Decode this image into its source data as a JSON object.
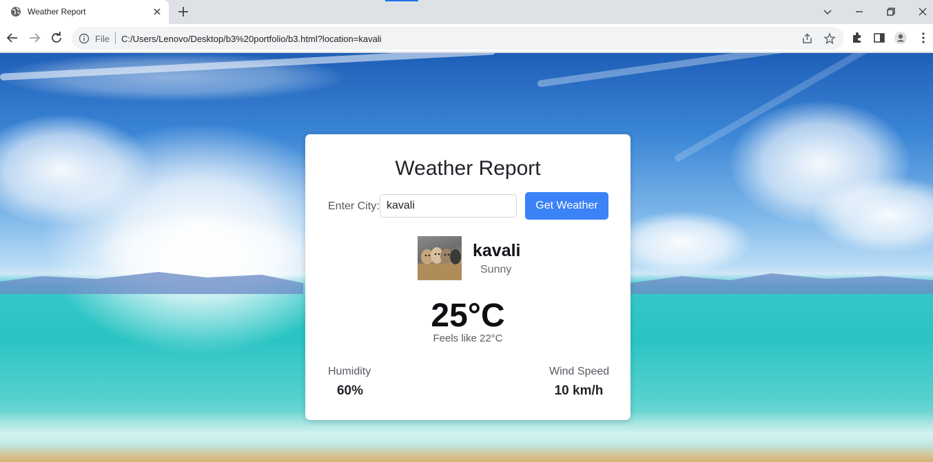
{
  "browser": {
    "tab": {
      "title": "Weather Report"
    },
    "address_bar": {
      "scheme_label": "File",
      "url": "C:/Users/Lenovo/Desktop/b3%20portfolio/b3.html?location=kavali"
    }
  },
  "page": {
    "title": "Weather Report",
    "form": {
      "city_label": "Enter City:",
      "city_value": "kavali",
      "submit_label": "Get Weather"
    },
    "current": {
      "city": "kavali",
      "condition": "Sunny",
      "temperature": "25°C",
      "feels_like": "Feels like 22°C"
    },
    "details": {
      "humidity_label": "Humidity",
      "humidity_value": "60%",
      "wind_label": "Wind Speed",
      "wind_value": "10 km/h"
    }
  },
  "colors": {
    "accent": "#3b82f6",
    "chrome_bg": "#dee1e6",
    "omnibox_bg": "#f1f3f4",
    "card_bg": "#ffffff"
  },
  "icons": [
    "globe-icon",
    "close-icon",
    "plus-icon",
    "chevron-down-icon",
    "minimize-icon",
    "restore-icon",
    "back-arrow-icon",
    "forward-arrow-icon",
    "reload-icon",
    "info-icon",
    "share-icon",
    "star-icon",
    "extensions-icon",
    "side-panel-icon",
    "profile-icon",
    "kebab-menu-icon"
  ]
}
